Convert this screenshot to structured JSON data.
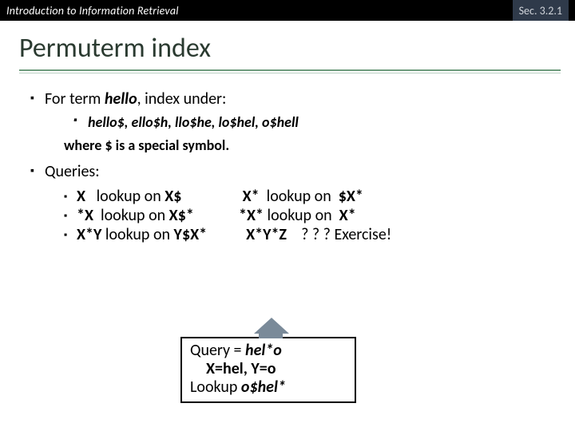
{
  "header": {
    "course": "Introduction to Information Retrieval",
    "section": "Sec. 3.2.1"
  },
  "title": "Permuterm index",
  "bullets": {
    "b1_pre": "For term ",
    "b1_term": "hello",
    "b1_post": ", index under:",
    "b1_sub": "hello$, ello$h, llo$he, lo$hel, o$hell",
    "b1_note": "where $ is a special symbol.",
    "b2": "Queries:"
  },
  "queries": {
    "r1l_q": "X",
    "r1l_txt": "lookup on ",
    "r1l_key": "X$",
    "r1r_q": "X*",
    "r1r_txt": "lookup on  ",
    "r1r_key": "$X*",
    "r2l_q": "*X",
    "r2l_txt": "lookup on ",
    "r2l_key": "X$*",
    "r2r_q": "*X*",
    "r2r_txt": "lookup on  ",
    "r2r_key": "X*",
    "r3l_q": "X*Y",
    "r3l_txt": "lookup on ",
    "r3l_key": "Y$X*",
    "r3r_q": "X*Y*Z",
    "r3r_txt": "? ? ? Exercise!"
  },
  "callout": {
    "l1a": "Query = ",
    "l1b": "hel*o",
    "l2": "X=hel, Y=o",
    "l3a": "Lookup ",
    "l3b": "o$hel*"
  }
}
